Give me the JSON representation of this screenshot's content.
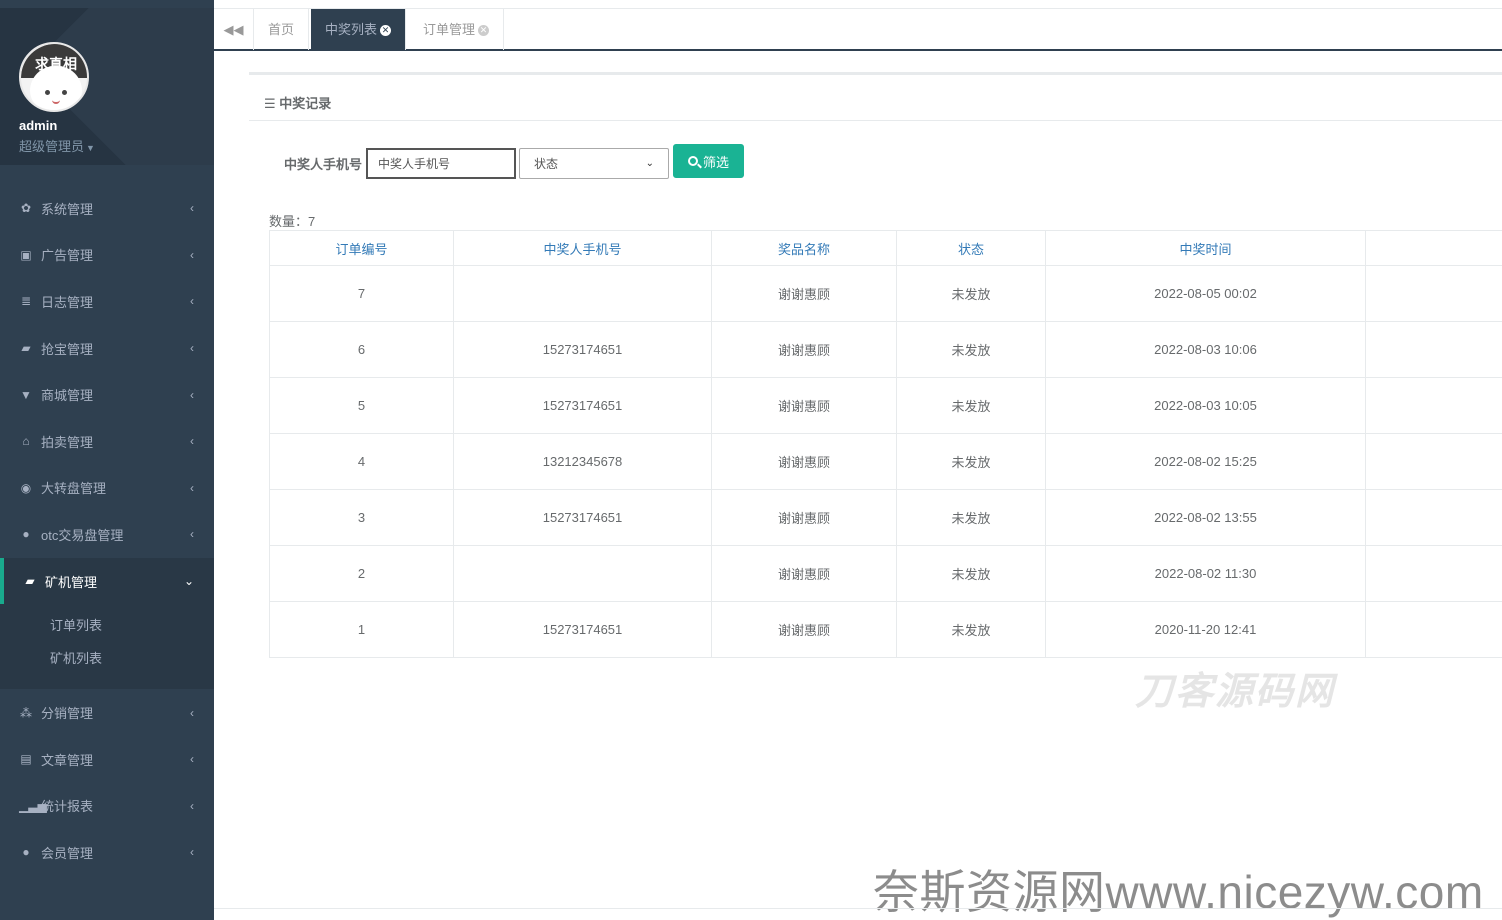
{
  "user": {
    "avatar_text": "求真相",
    "name": "admin",
    "role": "超级管理员"
  },
  "sidebar": {
    "items": [
      {
        "label": "系统管理",
        "icon": "gear-icon",
        "glyph": "✿"
      },
      {
        "label": "广告管理",
        "icon": "image-icon",
        "glyph": "▣"
      },
      {
        "label": "日志管理",
        "icon": "server-icon",
        "glyph": "≣"
      },
      {
        "label": "抢宝管理",
        "icon": "book-icon",
        "glyph": "▰"
      },
      {
        "label": "商城管理",
        "icon": "cart-icon",
        "glyph": "▼"
      },
      {
        "label": "拍卖管理",
        "icon": "bank-icon",
        "glyph": "⌂"
      },
      {
        "label": "大转盘管理",
        "icon": "gamepad-icon",
        "glyph": "◉"
      },
      {
        "label": "otc交易盘管理",
        "icon": "user-icon",
        "glyph": "●"
      }
    ],
    "active": {
      "label": "矿机管理",
      "icon": "book-icon",
      "glyph": "▰"
    },
    "sub_items": [
      {
        "label": "订单列表"
      },
      {
        "label": "矿机列表"
      }
    ],
    "items_after": [
      {
        "label": "分销管理",
        "icon": "cubes-icon",
        "glyph": "⁂"
      },
      {
        "label": "文章管理",
        "icon": "archive-icon",
        "glyph": "▤"
      },
      {
        "label": "统计报表",
        "icon": "signal-icon",
        "glyph": "▁▃▅"
      },
      {
        "label": "会员管理",
        "icon": "user-icon",
        "glyph": "●"
      }
    ]
  },
  "tabs": [
    {
      "label": "首页"
    },
    {
      "label": "中奖列表"
    },
    {
      "label": "订单管理"
    }
  ],
  "panel": {
    "title": "中奖记录"
  },
  "filter": {
    "label": "中奖人手机号",
    "phone_placeholder": "中奖人手机号",
    "status_selected": "状态",
    "button_label": "筛选"
  },
  "count_text": "数量：7",
  "table": {
    "headers": [
      "订单编号",
      "中奖人手机号",
      "奖品名称",
      "状态",
      "中奖时间",
      ""
    ],
    "rows": [
      [
        "7",
        "",
        "谢谢惠顾",
        "未发放",
        "2022-08-05 00:02",
        ""
      ],
      [
        "6",
        "15273174651",
        "谢谢惠顾",
        "未发放",
        "2022-08-03 10:06",
        ""
      ],
      [
        "5",
        "15273174651",
        "谢谢惠顾",
        "未发放",
        "2022-08-03 10:05",
        ""
      ],
      [
        "4",
        "13212345678",
        "谢谢惠顾",
        "未发放",
        "2022-08-02 15:25",
        ""
      ],
      [
        "3",
        "15273174651",
        "谢谢惠顾",
        "未发放",
        "2022-08-02 13:55",
        ""
      ],
      [
        "2",
        "",
        "谢谢惠顾",
        "未发放",
        "2022-08-02 11:30",
        ""
      ],
      [
        "1",
        "15273174651",
        "谢谢惠顾",
        "未发放",
        "2020-11-20 12:41",
        ""
      ]
    ]
  },
  "watermarks": {
    "top": "刀客源码网",
    "bottom": "奈斯资源网www.nicezyw.com"
  },
  "colors": {
    "sidebar_bg": "#2f4050",
    "accent": "#1ab394",
    "link": "#337ab7"
  }
}
